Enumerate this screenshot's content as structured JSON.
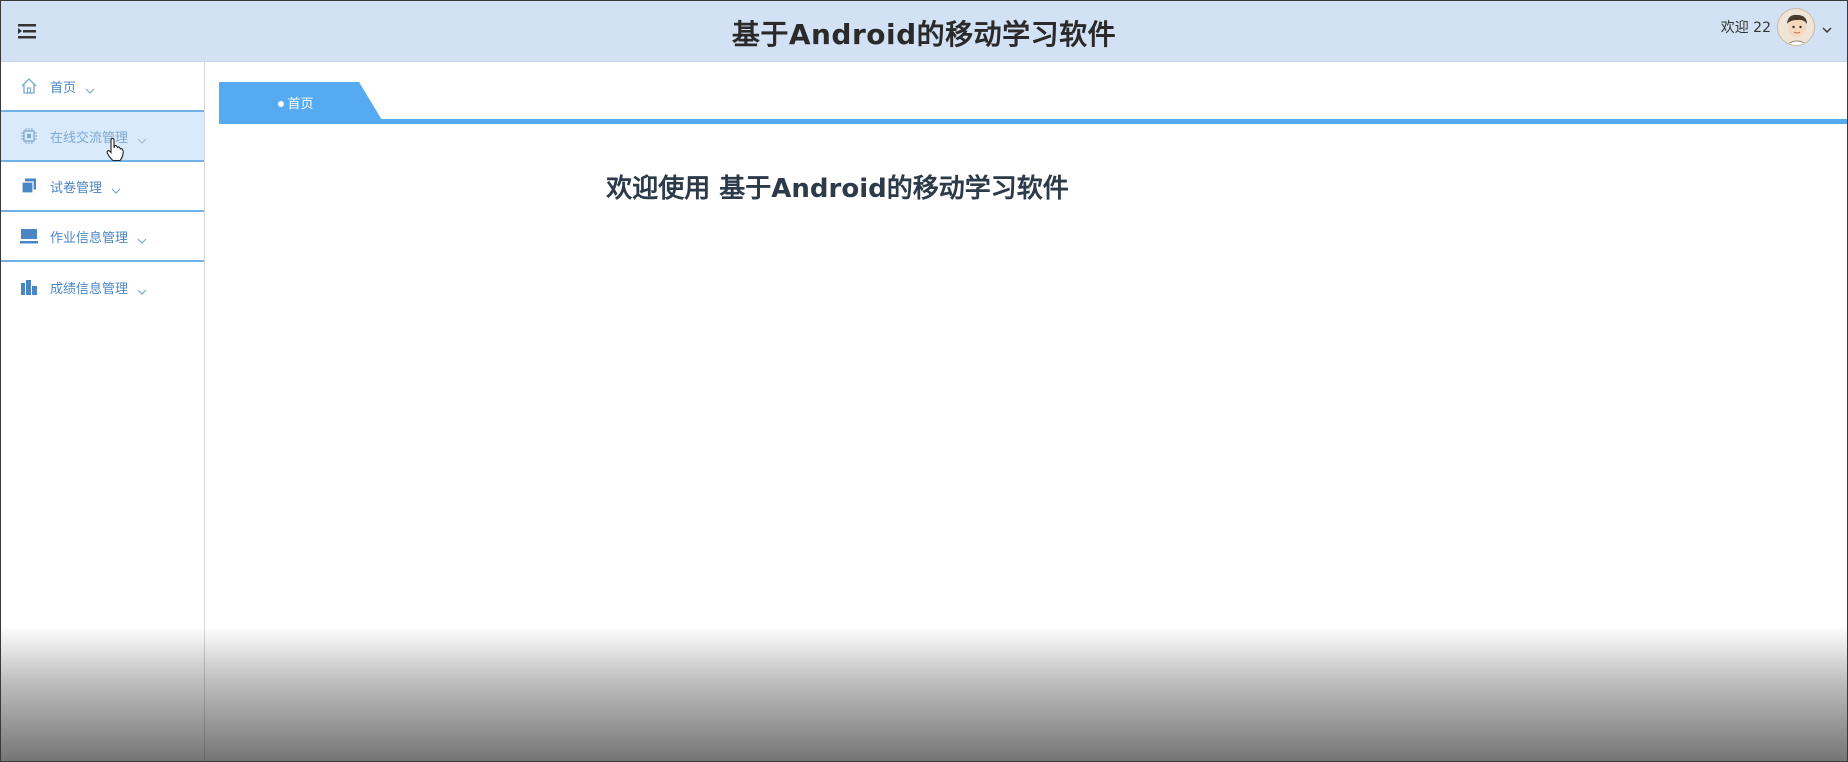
{
  "header": {
    "title": "基于Android的移动学习软件",
    "welcome": "欢迎 22",
    "menu_icon": "hamburger-icon",
    "avatar_icon": "user-avatar"
  },
  "sidebar": {
    "items": [
      {
        "label": "首页",
        "icon": "home-icon"
      },
      {
        "label": "在线交流管理",
        "icon": "chip-icon"
      },
      {
        "label": "试卷管理",
        "icon": "stack-icon"
      },
      {
        "label": "作业信息管理",
        "icon": "monitor-icon"
      },
      {
        "label": "成绩信息管理",
        "icon": "buildings-icon"
      }
    ]
  },
  "tabs": [
    {
      "label": "首页"
    }
  ],
  "main": {
    "heading": "欢迎使用 基于Android的移动学习软件"
  },
  "colors": {
    "header_bg": "#d2e2f4",
    "accent": "#55aaf0",
    "sidebar_text": "#4a86c4",
    "active_bg": "#d8eafb"
  }
}
